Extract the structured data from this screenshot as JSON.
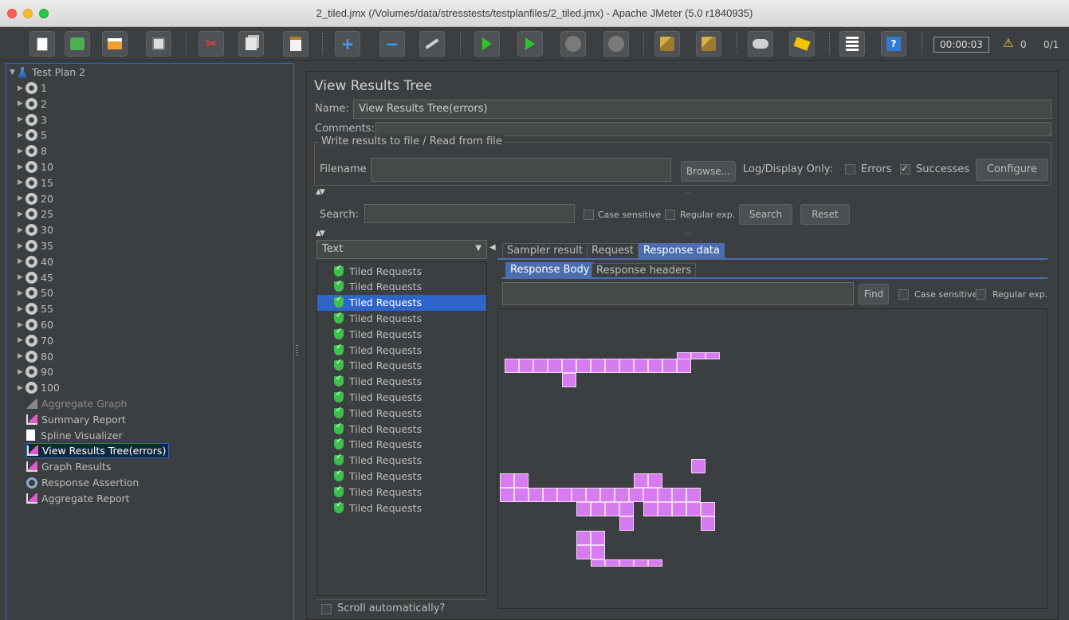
{
  "window": {
    "title": "2_tiled.jmx (/Volumes/data/stresstests/testplanfiles/2_tiled.jmx) - Apache JMeter (5.0 r1840935)"
  },
  "toolbar": {
    "timer": "00:00:03",
    "warning_count": "0",
    "threads": "0/1",
    "icons": [
      "new-icon",
      "templates-icon",
      "open-icon",
      "save-icon",
      "cut-icon",
      "copy-icon",
      "paste-icon",
      "expand-icon",
      "collapse-icon",
      "toggle-icon",
      "start-icon",
      "start-no-pauses-icon",
      "stop-icon",
      "shutdown-icon",
      "clear-icon",
      "clear-all-icon",
      "search-icon",
      "reset-search-icon",
      "function-helper-icon",
      "help-icon"
    ]
  },
  "tree": {
    "root": "Test Plan 2",
    "thread_groups": [
      "1",
      "2",
      "3",
      "5",
      "8",
      "10",
      "15",
      "20",
      "25",
      "30",
      "35",
      "40",
      "45",
      "50",
      "55",
      "60",
      "70",
      "80",
      "90",
      "100"
    ],
    "listeners": [
      {
        "label": "Aggregate Graph",
        "icon": "aggregate-graph-icon",
        "disabled": true
      },
      {
        "label": "Summary Report",
        "icon": "chart-icon",
        "disabled": false
      },
      {
        "label": "Spline Visualizer",
        "icon": "document-icon",
        "disabled": false
      },
      {
        "label": "View Results Tree(errors)",
        "icon": "chart-icon",
        "disabled": false,
        "selected": true
      },
      {
        "label": "Graph Results",
        "icon": "chart-icon",
        "disabled": false
      },
      {
        "label": "Response Assertion",
        "icon": "magnifier-icon",
        "disabled": false
      },
      {
        "label": "Aggregate Report",
        "icon": "chart-icon",
        "disabled": false
      }
    ]
  },
  "panel": {
    "title": "View Results Tree",
    "name_label": "Name:",
    "name_value": "View Results Tree(errors)",
    "comments_label": "Comments:",
    "file_group_title": "Write results to file / Read from file",
    "filename_label": "Filename",
    "browse_button": "Browse...",
    "log_display_label": "Log/Display Only:",
    "errors_label": "Errors",
    "errors_checked": false,
    "successes_label": "Successes",
    "successes_checked": true,
    "configure_button": "Configure",
    "search_label": "Search:",
    "case_sensitive_label": "Case sensitive",
    "regex_label": "Regular exp.",
    "search_button": "Search",
    "reset_button": "Reset"
  },
  "results": {
    "renderer": "Text",
    "items": [
      "Tiled Requests",
      "Tiled Requests",
      "Tiled Requests",
      "Tiled Requests",
      "Tiled Requests",
      "Tiled Requests",
      "Tiled Requests",
      "Tiled Requests",
      "Tiled Requests",
      "Tiled Requests",
      "Tiled Requests",
      "Tiled Requests",
      "Tiled Requests",
      "Tiled Requests",
      "Tiled Requests",
      "Tiled Requests"
    ],
    "selected_index": 2,
    "scroll_auto_label": "Scroll automatically?"
  },
  "tabs": {
    "main": [
      "Sampler result",
      "Request",
      "Response data"
    ],
    "main_active": "Response data",
    "sub": [
      "Response Body",
      "Response headers"
    ],
    "sub_active": "Response Body",
    "find_button": "Find",
    "case_sensitive_label": "Case sensitive",
    "regex_label": "Regular exp."
  },
  "colors": {
    "accent": "#2f65ca",
    "tab_active": "#4b6eaf",
    "tile": "#d77cf0",
    "success": "#3fbf4d"
  }
}
